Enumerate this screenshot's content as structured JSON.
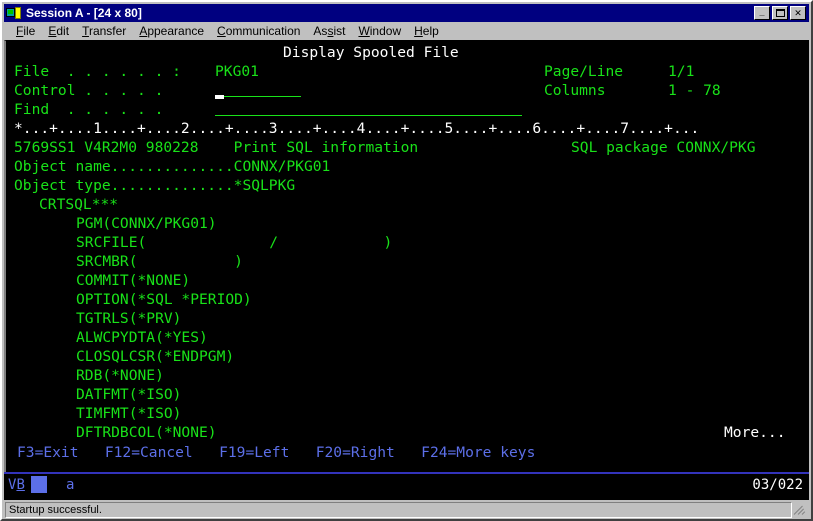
{
  "window": {
    "title": "Session A - [24 x 80]",
    "icon": "terminal-session-icon",
    "buttons": {
      "minimize": "_",
      "maximize": "□",
      "close": "×"
    }
  },
  "menu": {
    "items": [
      {
        "label": "File",
        "mnemonic": "F"
      },
      {
        "label": "Edit",
        "mnemonic": "E"
      },
      {
        "label": "Transfer",
        "mnemonic": "T"
      },
      {
        "label": "Appearance",
        "mnemonic": "A"
      },
      {
        "label": "Communication",
        "mnemonic": "C"
      },
      {
        "label": "Assist",
        "mnemonic": "s"
      },
      {
        "label": "Window",
        "mnemonic": "W"
      },
      {
        "label": "Help",
        "mnemonic": "H"
      }
    ]
  },
  "screen": {
    "title": "Display Spooled File",
    "labels": {
      "file": "File  . . . . . . :",
      "control": "Control . . . . .",
      "find": "Find  . . . . . .",
      "page_line": "Page/Line",
      "columns": "Columns"
    },
    "values": {
      "file": "PKG01",
      "control": "",
      "find": "",
      "page_line": "1/1",
      "columns": "1 - 78"
    },
    "ruler": "*...+....1....+....2....+....3....+....4....+....5....+....6....+....7....+...",
    "report": {
      "header_left": "5769SS1 V4R2M0 980228    Print SQL information",
      "header_right": "SQL package CONNX/PKG",
      "object_name": "Object name..............CONNX/PKG01",
      "object_type": "Object type..............*SQLPKG",
      "command": "CRTSQL***",
      "parameters": [
        "PGM(CONNX/PKG01)",
        "SRCFILE(              /            )",
        "SRCMBR(           )",
        "COMMIT(*NONE)",
        "OPTION(*SQL *PERIOD)",
        "TGTRLS(*PRV)",
        "ALWCPYDTA(*YES)",
        "CLOSQLCSR(*ENDPGM)",
        "RDB(*NONE)",
        "DATFMT(*ISO)",
        "TIMFMT(*ISO)",
        "DFTRDBCOL(*NONE)"
      ]
    },
    "more_indicator": "More...",
    "function_keys": "F3=Exit   F12=Cancel   F19=Left   F20=Right   F24=More keys"
  },
  "oia": {
    "system_indicator": "VB",
    "input_mode": "a",
    "cursor_position": "03/022"
  },
  "status_bar": {
    "message": "Startup successful."
  },
  "colors": {
    "title_bar": "#000080",
    "terminal_bg": "#000000",
    "terminal_green": "#19e219",
    "terminal_white": "#ffffff",
    "terminal_blue": "#5c6fe8",
    "window_face": "#c0c0c0"
  }
}
